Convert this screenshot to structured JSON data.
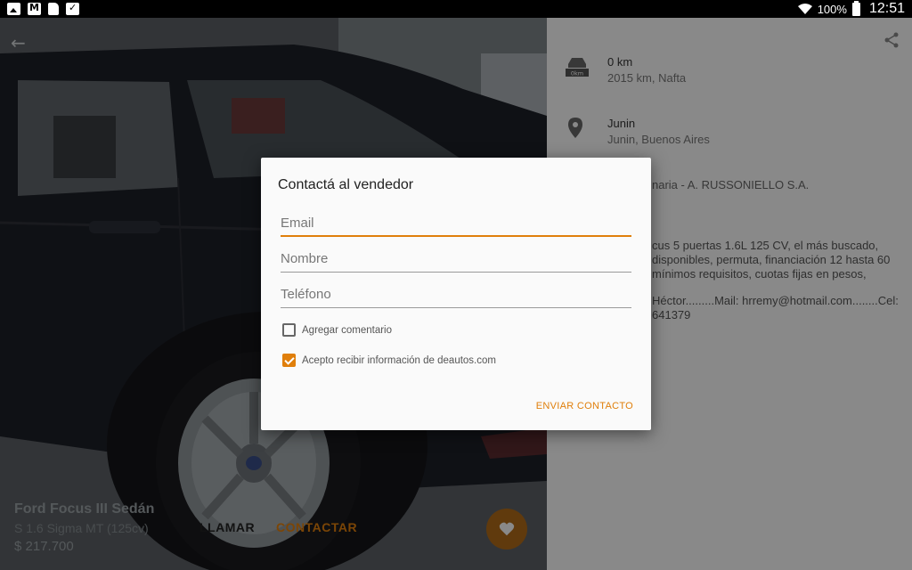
{
  "status_bar": {
    "battery_pct": "100%",
    "time": "12:51",
    "icons": [
      "image-icon",
      "gmail-icon",
      "sd-card-icon",
      "clipboard-icon",
      "wifi-icon",
      "battery-icon"
    ]
  },
  "listing": {
    "title": "Ford Focus III Sedán",
    "subtitle": "S 1.6 Sigma MT (125cv)",
    "price": "$ 217.700"
  },
  "details": {
    "km": {
      "title": "0 km",
      "subtitle": "2015  km, Nafta"
    },
    "location": {
      "title": "Junin",
      "subtitle": "Junin, Buenos Aires"
    },
    "seller_partial": "naria - A. RUSSONIELLO S.A.",
    "description_lines": [
      "cus 5 puertas 1.6L 125 CV, el más buscado,",
      "disponibles, permuta, financiación 12 hasta 60",
      "mínimos requisitos, cuotas fijas en pesos,"
    ],
    "contact_lines": [
      "Héctor.........Mail: hrremy@hotmail.com........Cel:",
      "641379"
    ]
  },
  "actions": {
    "call_label": "LLAMAR",
    "contact_label": "CONTACTAR"
  },
  "dialog": {
    "title": "Contactá al vendedor",
    "email_placeholder": "Email",
    "name_placeholder": "Nombre",
    "phone_placeholder": "Teléfono",
    "add_comment_label": "Agregar comentario",
    "add_comment_checked": false,
    "accept_info_label": "Acepto recibir información de deautos.com",
    "accept_info_checked": true,
    "send_label": "ENVIAR CONTACTO"
  },
  "colors": {
    "accent": "#e07f0b",
    "fab": "#b06a19"
  }
}
